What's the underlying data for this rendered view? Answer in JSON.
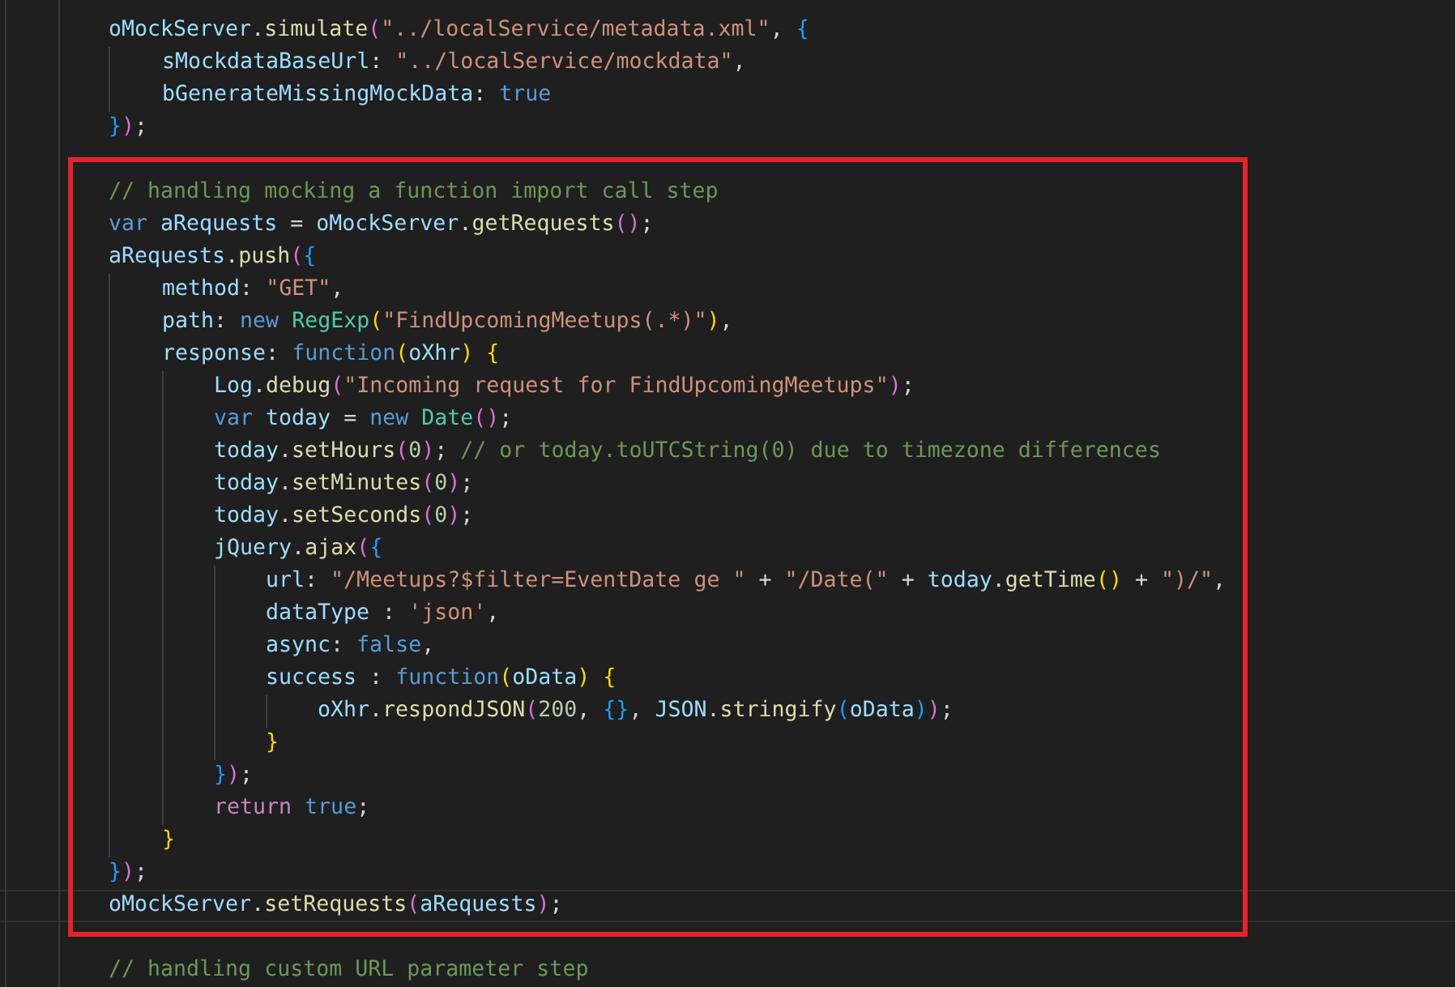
{
  "editor": {
    "lines": [
      {
        "kind": "code",
        "tokens": [
          {
            "text": "oMockServer",
            "kind": "var"
          },
          {
            "text": ".",
            "kind": "plain"
          },
          {
            "text": "simulate",
            "kind": "fn"
          },
          {
            "text": "(",
            "kind": "b2"
          },
          {
            "text": "\"../localService/metadata.xml\"",
            "kind": "str"
          },
          {
            "text": ", ",
            "kind": "plain"
          },
          {
            "text": "{",
            "kind": "b3"
          }
        ],
        "children": [
          {
            "kind": "code",
            "tokens": [
              {
                "text": "sMockdataBaseUrl",
                "kind": "var"
              },
              {
                "text": ": ",
                "kind": "plain"
              },
              {
                "text": "\"../localService/mockdata\"",
                "kind": "str"
              },
              {
                "text": ",",
                "kind": "plain"
              }
            ]
          },
          {
            "kind": "code",
            "tokens": [
              {
                "text": "bGenerateMissingMockData",
                "kind": "var"
              },
              {
                "text": ": ",
                "kind": "plain"
              },
              {
                "text": "true",
                "kind": "kw"
              }
            ]
          }
        ]
      },
      {
        "kind": "code",
        "tokens": [
          {
            "text": "}",
            "kind": "b3"
          },
          {
            "text": ")",
            "kind": "b2"
          },
          {
            "text": ";",
            "kind": "plain"
          }
        ]
      },
      {
        "kind": "blank"
      },
      {
        "kind": "code",
        "tokens": [
          {
            "text": "// handling mocking a function import call step",
            "kind": "cm"
          }
        ]
      },
      {
        "kind": "code",
        "tokens": [
          {
            "text": "var ",
            "kind": "kw"
          },
          {
            "text": "aRequests",
            "kind": "var"
          },
          {
            "text": " = ",
            "kind": "plain"
          },
          {
            "text": "oMockServer",
            "kind": "var"
          },
          {
            "text": ".",
            "kind": "plain"
          },
          {
            "text": "getRequests",
            "kind": "fn"
          },
          {
            "text": "()",
            "kind": "b2"
          },
          {
            "text": ";",
            "kind": "plain"
          }
        ]
      },
      {
        "kind": "code",
        "tokens": [
          {
            "text": "aRequests",
            "kind": "var"
          },
          {
            "text": ".",
            "kind": "plain"
          },
          {
            "text": "push",
            "kind": "fn"
          },
          {
            "text": "(",
            "kind": "b2"
          },
          {
            "text": "{",
            "kind": "b3"
          }
        ],
        "children": [
          {
            "kind": "code",
            "tokens": [
              {
                "text": "method",
                "kind": "var"
              },
              {
                "text": ": ",
                "kind": "plain"
              },
              {
                "text": "\"GET\"",
                "kind": "str"
              },
              {
                "text": ",",
                "kind": "plain"
              }
            ]
          },
          {
            "kind": "code",
            "tokens": [
              {
                "text": "path",
                "kind": "var"
              },
              {
                "text": ": ",
                "kind": "plain"
              },
              {
                "text": "new ",
                "kind": "kw"
              },
              {
                "text": "RegExp",
                "kind": "cls"
              },
              {
                "text": "(",
                "kind": "b1"
              },
              {
                "text": "\"FindUpcomingMeetups(.*)\"",
                "kind": "str"
              },
              {
                "text": ")",
                "kind": "b1"
              },
              {
                "text": ",",
                "kind": "plain"
              }
            ]
          },
          {
            "kind": "code",
            "tokens": [
              {
                "text": "response",
                "kind": "var"
              },
              {
                "text": ": ",
                "kind": "plain"
              },
              {
                "text": "function",
                "kind": "kw"
              },
              {
                "text": "(",
                "kind": "b1"
              },
              {
                "text": "oXhr",
                "kind": "var"
              },
              {
                "text": ") {",
                "kind": "b1"
              }
            ],
            "children": [
              {
                "kind": "code",
                "tokens": [
                  {
                    "text": "Log",
                    "kind": "var"
                  },
                  {
                    "text": ".",
                    "kind": "plain"
                  },
                  {
                    "text": "debug",
                    "kind": "fn"
                  },
                  {
                    "text": "(",
                    "kind": "b2"
                  },
                  {
                    "text": "\"Incoming request for FindUpcomingMeetups\"",
                    "kind": "str"
                  },
                  {
                    "text": ")",
                    "kind": "b2"
                  },
                  {
                    "text": ";",
                    "kind": "plain"
                  }
                ]
              },
              {
                "kind": "code",
                "tokens": [
                  {
                    "text": "var ",
                    "kind": "kw"
                  },
                  {
                    "text": "today",
                    "kind": "var"
                  },
                  {
                    "text": " = ",
                    "kind": "plain"
                  },
                  {
                    "text": "new ",
                    "kind": "kw"
                  },
                  {
                    "text": "Date",
                    "kind": "cls"
                  },
                  {
                    "text": "()",
                    "kind": "b2"
                  },
                  {
                    "text": ";",
                    "kind": "plain"
                  }
                ]
              },
              {
                "kind": "code",
                "tokens": [
                  {
                    "text": "today",
                    "kind": "var"
                  },
                  {
                    "text": ".",
                    "kind": "plain"
                  },
                  {
                    "text": "setHours",
                    "kind": "fn"
                  },
                  {
                    "text": "(",
                    "kind": "b2"
                  },
                  {
                    "text": "0",
                    "kind": "num"
                  },
                  {
                    "text": ")",
                    "kind": "b2"
                  },
                  {
                    "text": "; ",
                    "kind": "plain"
                  },
                  {
                    "text": "// or today.toUTCString(0) due to timezone differences",
                    "kind": "cm"
                  }
                ]
              },
              {
                "kind": "code",
                "tokens": [
                  {
                    "text": "today",
                    "kind": "var"
                  },
                  {
                    "text": ".",
                    "kind": "plain"
                  },
                  {
                    "text": "setMinutes",
                    "kind": "fn"
                  },
                  {
                    "text": "(",
                    "kind": "b2"
                  },
                  {
                    "text": "0",
                    "kind": "num"
                  },
                  {
                    "text": ")",
                    "kind": "b2"
                  },
                  {
                    "text": ";",
                    "kind": "plain"
                  }
                ]
              },
              {
                "kind": "code",
                "tokens": [
                  {
                    "text": "today",
                    "kind": "var"
                  },
                  {
                    "text": ".",
                    "kind": "plain"
                  },
                  {
                    "text": "setSeconds",
                    "kind": "fn"
                  },
                  {
                    "text": "(",
                    "kind": "b2"
                  },
                  {
                    "text": "0",
                    "kind": "num"
                  },
                  {
                    "text": ")",
                    "kind": "b2"
                  },
                  {
                    "text": ";",
                    "kind": "plain"
                  }
                ]
              },
              {
                "kind": "code",
                "tokens": [
                  {
                    "text": "jQuery",
                    "kind": "var"
                  },
                  {
                    "text": ".",
                    "kind": "plain"
                  },
                  {
                    "text": "ajax",
                    "kind": "fn"
                  },
                  {
                    "text": "(",
                    "kind": "b2"
                  },
                  {
                    "text": "{",
                    "kind": "b3"
                  }
                ],
                "children": [
                  {
                    "kind": "code",
                    "tokens": [
                      {
                        "text": "url",
                        "kind": "var"
                      },
                      {
                        "text": ": ",
                        "kind": "plain"
                      },
                      {
                        "text": "\"/Meetups?$filter=EventDate ge \"",
                        "kind": "str"
                      },
                      {
                        "text": " + ",
                        "kind": "plain"
                      },
                      {
                        "text": "\"/Date(\"",
                        "kind": "str"
                      },
                      {
                        "text": " + ",
                        "kind": "plain"
                      },
                      {
                        "text": "today",
                        "kind": "var"
                      },
                      {
                        "text": ".",
                        "kind": "plain"
                      },
                      {
                        "text": "getTime",
                        "kind": "fn"
                      },
                      {
                        "text": "()",
                        "kind": "b1"
                      },
                      {
                        "text": " + ",
                        "kind": "plain"
                      },
                      {
                        "text": "\")/\"",
                        "kind": "str"
                      },
                      {
                        "text": ",",
                        "kind": "plain"
                      }
                    ]
                  },
                  {
                    "kind": "code",
                    "tokens": [
                      {
                        "text": "dataType",
                        "kind": "var"
                      },
                      {
                        "text": " : ",
                        "kind": "plain"
                      },
                      {
                        "text": "'json'",
                        "kind": "str"
                      },
                      {
                        "text": ",",
                        "kind": "plain"
                      }
                    ]
                  },
                  {
                    "kind": "code",
                    "tokens": [
                      {
                        "text": "async",
                        "kind": "var"
                      },
                      {
                        "text": ": ",
                        "kind": "plain"
                      },
                      {
                        "text": "false",
                        "kind": "kw"
                      },
                      {
                        "text": ",",
                        "kind": "plain"
                      }
                    ]
                  },
                  {
                    "kind": "code",
                    "tokens": [
                      {
                        "text": "success",
                        "kind": "var"
                      },
                      {
                        "text": " : ",
                        "kind": "plain"
                      },
                      {
                        "text": "function",
                        "kind": "kw"
                      },
                      {
                        "text": "(",
                        "kind": "b1"
                      },
                      {
                        "text": "oData",
                        "kind": "var"
                      },
                      {
                        "text": ") {",
                        "kind": "b1"
                      }
                    ],
                    "children": [
                      {
                        "kind": "code",
                        "tokens": [
                          {
                            "text": "oXhr",
                            "kind": "var"
                          },
                          {
                            "text": ".",
                            "kind": "plain"
                          },
                          {
                            "text": "respondJSON",
                            "kind": "fn"
                          },
                          {
                            "text": "(",
                            "kind": "b2"
                          },
                          {
                            "text": "200",
                            "kind": "num"
                          },
                          {
                            "text": ", ",
                            "kind": "plain"
                          },
                          {
                            "text": "{}",
                            "kind": "b3"
                          },
                          {
                            "text": ", ",
                            "kind": "plain"
                          },
                          {
                            "text": "JSON",
                            "kind": "var"
                          },
                          {
                            "text": ".",
                            "kind": "plain"
                          },
                          {
                            "text": "stringify",
                            "kind": "fn"
                          },
                          {
                            "text": "(",
                            "kind": "b3"
                          },
                          {
                            "text": "oData",
                            "kind": "var"
                          },
                          {
                            "text": ")",
                            "kind": "b3"
                          },
                          {
                            "text": ")",
                            "kind": "b2"
                          },
                          {
                            "text": ";",
                            "kind": "plain"
                          }
                        ]
                      }
                    ]
                  },
                  {
                    "kind": "code",
                    "tokens": [
                      {
                        "text": "}",
                        "kind": "b1"
                      }
                    ]
                  }
                ]
              },
              {
                "kind": "code",
                "tokens": [
                  {
                    "text": "}",
                    "kind": "b3"
                  },
                  {
                    "text": ")",
                    "kind": "b2"
                  },
                  {
                    "text": ";",
                    "kind": "plain"
                  }
                ]
              },
              {
                "kind": "code",
                "tokens": [
                  {
                    "text": "return ",
                    "kind": "ctl"
                  },
                  {
                    "text": "true",
                    "kind": "kw"
                  },
                  {
                    "text": ";",
                    "kind": "plain"
                  }
                ]
              }
            ]
          },
          {
            "kind": "code",
            "tokens": [
              {
                "text": "}",
                "kind": "b1"
              }
            ]
          }
        ]
      },
      {
        "kind": "code",
        "tokens": [
          {
            "text": "}",
            "kind": "b3"
          },
          {
            "text": ")",
            "kind": "b2"
          },
          {
            "text": ";",
            "kind": "plain"
          }
        ]
      },
      {
        "kind": "code",
        "current": true,
        "tokens": [
          {
            "text": "oMockServer",
            "kind": "var"
          },
          {
            "text": ".",
            "kind": "plain"
          },
          {
            "text": "setRequests",
            "kind": "fn"
          },
          {
            "text": "(",
            "kind": "b2"
          },
          {
            "text": "aRequests",
            "kind": "var"
          },
          {
            "text": ")",
            "kind": "b2"
          },
          {
            "text": ";",
            "kind": "plain"
          }
        ]
      },
      {
        "kind": "blank"
      },
      {
        "kind": "code",
        "tokens": [
          {
            "text": "// handling custom URL parameter step",
            "kind": "cm"
          }
        ]
      }
    ]
  }
}
